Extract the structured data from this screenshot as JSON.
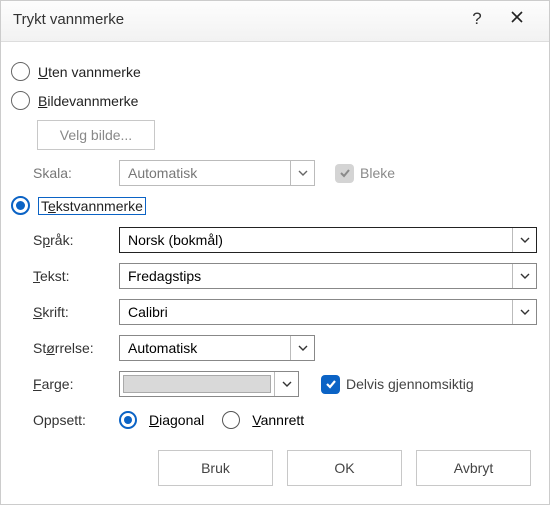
{
  "title": "Trykt vannmerke",
  "options": {
    "none": "Uten vannmerke",
    "picture": "Bildevannmerke",
    "text": "Tekstvannmerke",
    "selected": "text"
  },
  "picture": {
    "select_btn": "Velg bilde...",
    "scale_label": "Skala:",
    "scale_value": "Automatisk",
    "washout_label": "Bleke"
  },
  "text": {
    "language_label": "Språk:",
    "language_value": "Norsk (bokmål)",
    "text_label": "Tekst:",
    "text_value": "Fredagstips",
    "font_label": "Skrift:",
    "font_value": "Calibri",
    "size_label": "Størrelse:",
    "size_value": "Automatisk",
    "color_label": "Farge:",
    "semitrans_label": "Delvis gjennomsiktig",
    "layout_label": "Oppsett:",
    "diagonal": "Diagonal",
    "horizontal": "Vannrett",
    "layout_selected": "diagonal"
  },
  "buttons": {
    "apply": "Bruk",
    "ok": "OK",
    "cancel": "Avbryt"
  }
}
